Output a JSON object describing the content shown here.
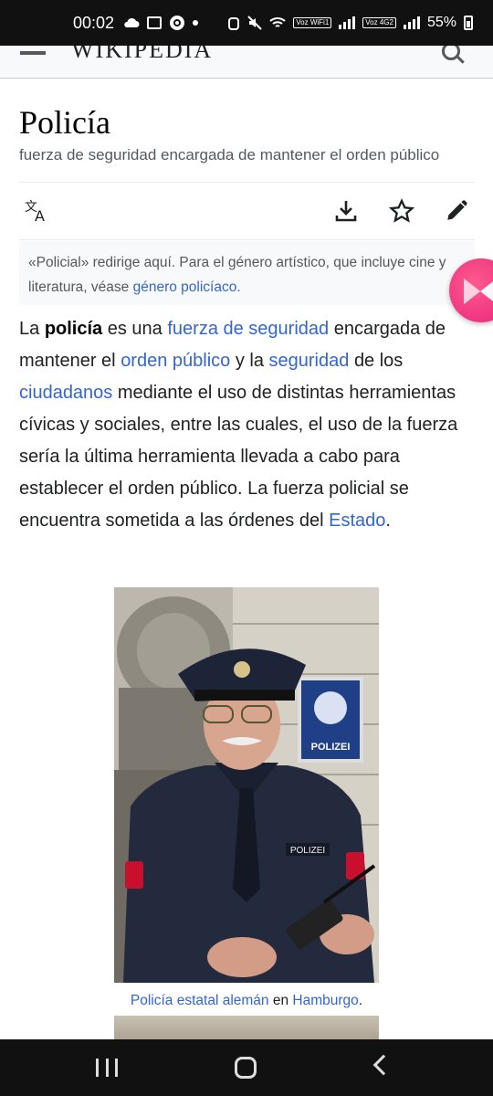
{
  "status_bar": {
    "time": "00:02",
    "battery": "55%",
    "badges": [
      "Voz WiFi1",
      "Voz 4G2"
    ],
    "icons": [
      "cloud-icon",
      "gallery-icon",
      "record-icon",
      "dot-icon",
      "alarm-icon",
      "mute-icon",
      "wifi-icon",
      "signal-icon",
      "battery-icon"
    ]
  },
  "header": {
    "logo": "WIKIPEDIA",
    "icons": [
      "menu-icon",
      "search-icon"
    ]
  },
  "article": {
    "title": "Policía",
    "subtitle": "fuerza de seguridad encargada de mantener el orden público",
    "actions": [
      "translate-icon",
      "download-icon",
      "star-icon",
      "edit-icon"
    ],
    "hatnote": {
      "text": "«Policial» redirige aquí. Para el género artístico, que incluye cine y literatura, véase",
      "link": "género policíaco",
      "end": "."
    },
    "paragraph": {
      "p1": "La",
      "bold": "policía",
      "p2": "es una",
      "link1": "fuerza de seguridad",
      "p3": "encargada de mantener el",
      "link2": "orden público",
      "p4": "y la",
      "link3": "seguridad",
      "p5": "de los",
      "link4": "ciudadanos",
      "p6": "mediante el uso de distintas herramientas cívicas y sociales, entre las cuales, el uso de la fuerza sería la última herramienta llevada a cabo para establecer el orden público. La fuerza policial se encuentra sometida a las órdenes del",
      "link5": "Estado",
      "p7": "."
    },
    "figure": {
      "sign_text": "POLIZEI",
      "badge_text": "POLIZEI",
      "caption_link1": "Policía estatal alemán",
      "caption_mid": "en",
      "caption_link2": "Hamburgo",
      "caption_end": "."
    }
  },
  "colors": {
    "link": "#3366cc",
    "hatnote_bg": "#f8f9fa",
    "fab": "#e6247a"
  },
  "nav_bar": {
    "icons": [
      "recent-apps-icon",
      "home-icon",
      "back-icon"
    ]
  }
}
